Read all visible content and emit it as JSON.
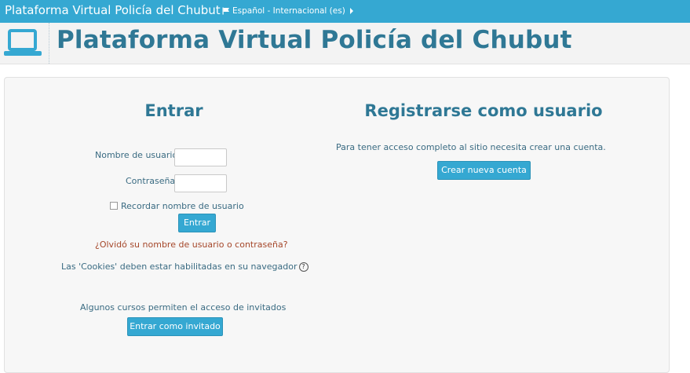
{
  "navbar": {
    "brand": "Plataforma Virtual Policía del Chubut",
    "language": "Español - Internacional (es)",
    "color": "#35a8d2"
  },
  "header": {
    "title": "Plataforma Virtual Policía del Chubut",
    "icon": "laptop-icon"
  },
  "login": {
    "heading": "Entrar",
    "username_label": "Nombre de usuario",
    "username_value": "",
    "password_label": "Contraseña",
    "password_value": "",
    "remember_label": "Recordar nombre de usuario",
    "remember_checked": false,
    "submit_label": "Entrar",
    "forgot_link": "¿Olvidó su nombre de usuario o contraseña?",
    "cookies_text": "Las 'Cookies' deben estar habilitadas en su navegador",
    "guest_text": "Algunos cursos permiten el acceso de invitados",
    "guest_button": "Entrar como invitado"
  },
  "signup": {
    "heading": "Registrarse como usuario",
    "text": "Para tener acceso completo al sitio necesita crear una cuenta.",
    "button": "Crear nueva cuenta"
  }
}
